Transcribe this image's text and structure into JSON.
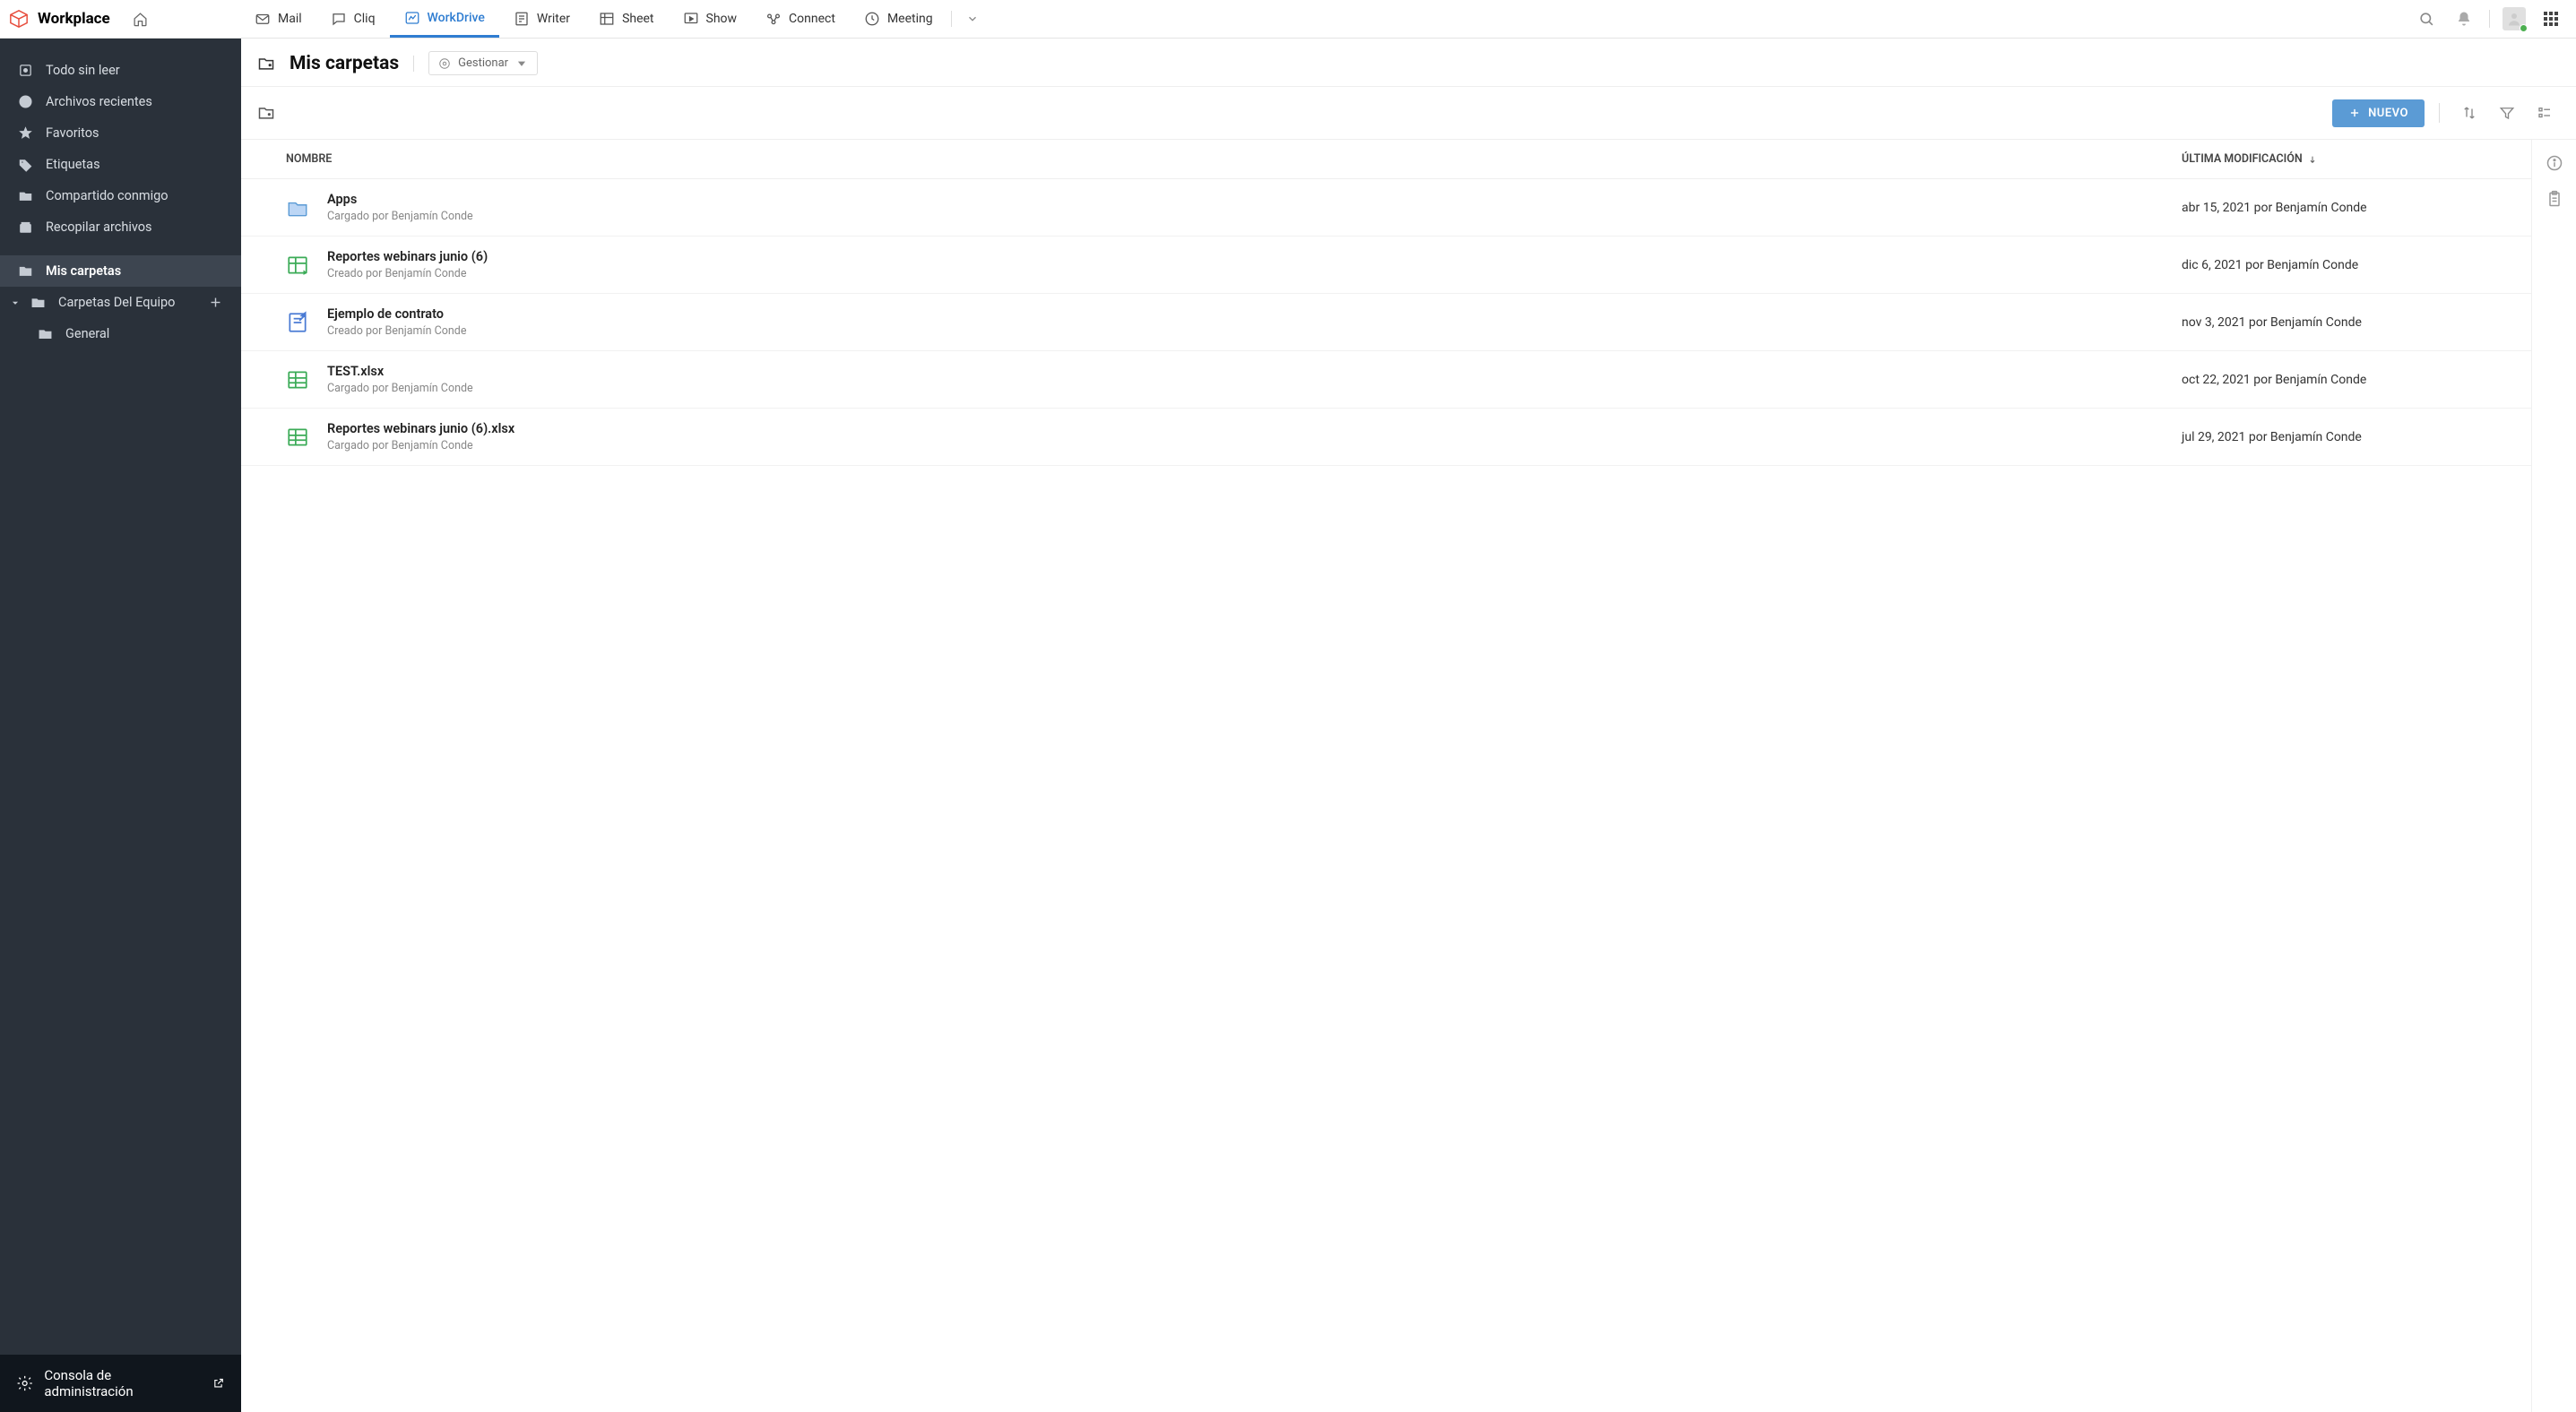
{
  "brand": {
    "name": "Workplace"
  },
  "apps": [
    {
      "id": "mail",
      "label": "Mail",
      "active": false
    },
    {
      "id": "cliq",
      "label": "Cliq",
      "active": false
    },
    {
      "id": "workdrive",
      "label": "WorkDrive",
      "active": true
    },
    {
      "id": "writer",
      "label": "Writer",
      "active": false
    },
    {
      "id": "sheet",
      "label": "Sheet",
      "active": false
    },
    {
      "id": "show",
      "label": "Show",
      "active": false
    },
    {
      "id": "connect",
      "label": "Connect",
      "active": false
    },
    {
      "id": "meeting",
      "label": "Meeting",
      "active": false
    }
  ],
  "sidebar": {
    "items": [
      {
        "id": "unread",
        "label": "Todo sin leer"
      },
      {
        "id": "recent",
        "label": "Archivos recientes"
      },
      {
        "id": "favorites",
        "label": "Favoritos"
      },
      {
        "id": "labels",
        "label": "Etiquetas"
      },
      {
        "id": "shared",
        "label": "Compartido conmigo"
      },
      {
        "id": "collect",
        "label": "Recopilar archivos"
      }
    ],
    "my_folders": {
      "label": "Mis carpetas"
    },
    "team_folders": {
      "label": "Carpetas Del Equipo",
      "children": [
        {
          "label": "General"
        }
      ]
    },
    "admin": {
      "label": "Consola de administración"
    }
  },
  "page": {
    "title": "Mis carpetas",
    "manage_label": "Gestionar",
    "new_button": "NUEVO",
    "columns": {
      "name": "NOMBRE",
      "modified": "ÚLTIMA MODIFICACIÓN"
    }
  },
  "files": [
    {
      "type": "folder",
      "name": "Apps",
      "meta": "Cargado por Benjamín Conde",
      "modified": "abr 15, 2021 por Benjamín Conde"
    },
    {
      "type": "sheet-zoho",
      "name": "Reportes webinars junio (6)",
      "meta": "Creado por Benjamín Conde",
      "modified": "dic 6, 2021 por Benjamín Conde"
    },
    {
      "type": "writer",
      "name": "Ejemplo de contrato",
      "meta": "Creado por Benjamín Conde",
      "modified": "nov 3, 2021 por Benjamín Conde"
    },
    {
      "type": "xls",
      "name": "TEST.xlsx",
      "meta": "Cargado por Benjamín Conde",
      "modified": "oct 22, 2021 por Benjamín Conde"
    },
    {
      "type": "xls",
      "name": "Reportes webinars junio (6).xlsx",
      "meta": "Cargado por Benjamín Conde",
      "modified": "jul 29, 2021 por Benjamín Conde"
    }
  ]
}
